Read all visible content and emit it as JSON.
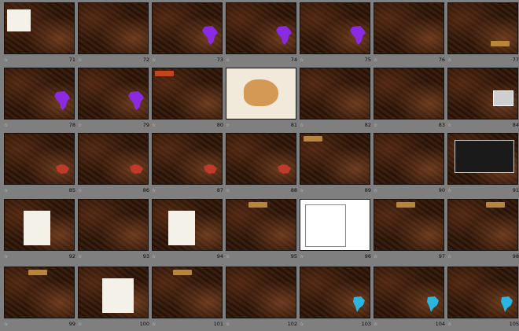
{
  "view": "slide-sorter",
  "star_icon": "star-icon",
  "colors": {
    "background": "#7f7f7f",
    "slide_bg": "#2a1408",
    "highlight_cyan": "#33ffff",
    "highlight_yellow": "#ffe94d",
    "africa_purple": "#8a2be2",
    "red_map": "#c0392b",
    "cyan_map": "#2bb6e0"
  },
  "slides": [
    {
      "num": "71",
      "lines": []
    },
    {
      "num": "72",
      "lines": []
    },
    {
      "num": "73",
      "lines": []
    },
    {
      "num": "74",
      "lines": []
    },
    {
      "num": "75",
      "lines": []
    },
    {
      "num": "76",
      "lines": []
    },
    {
      "num": "77",
      "lines": []
    },
    {
      "num": "78",
      "lines": []
    },
    {
      "num": "79",
      "lines": []
    },
    {
      "num": "80",
      "lines": []
    },
    {
      "num": "81",
      "lines": []
    },
    {
      "num": "82",
      "lines": []
    },
    {
      "num": "83",
      "lines": []
    },
    {
      "num": "84",
      "lines": []
    },
    {
      "num": "85",
      "lines": []
    },
    {
      "num": "86",
      "lines": []
    },
    {
      "num": "87",
      "lines": []
    },
    {
      "num": "88",
      "lines": []
    },
    {
      "num": "89",
      "lines": []
    },
    {
      "num": "90",
      "lines": []
    },
    {
      "num": "91",
      "lines": []
    },
    {
      "num": "92",
      "lines": []
    },
    {
      "num": "93",
      "lines": []
    },
    {
      "num": "94",
      "lines": []
    },
    {
      "num": "95",
      "lines": []
    },
    {
      "num": "96",
      "lines": []
    },
    {
      "num": "97",
      "lines": []
    },
    {
      "num": "98",
      "lines": []
    },
    {
      "num": "99",
      "lines": []
    },
    {
      "num": "100",
      "lines": []
    },
    {
      "num": "101",
      "lines": []
    },
    {
      "num": "102",
      "lines": []
    },
    {
      "num": "103",
      "lines": []
    },
    {
      "num": "104",
      "lines": []
    },
    {
      "num": "105",
      "lines": []
    }
  ]
}
